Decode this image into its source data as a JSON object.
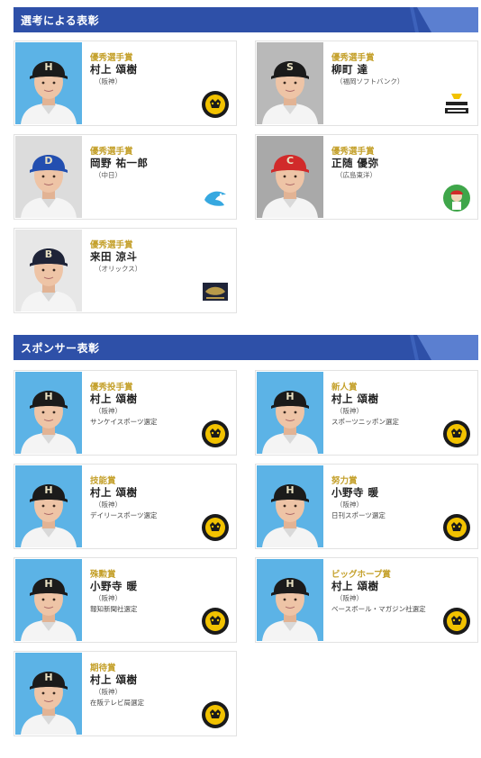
{
  "sections": [
    {
      "title": "選考による表彰",
      "cards": [
        {
          "award": "優秀選手賞",
          "name": "村上 頌樹",
          "team": "（阪神）",
          "sponsor": "",
          "photo_bg": "#5cb3e6",
          "cap": "#1b1b1b",
          "cap_mark": "H",
          "logo": "tigers-logo"
        },
        {
          "award": "優秀選手賞",
          "name": "柳町 達",
          "team": "（福岡ソフトバンク）",
          "sponsor": "",
          "photo_bg": "#b9b9b9",
          "cap": "#1b1b1b",
          "cap_mark": "S",
          "logo": "hawks-logo"
        },
        {
          "award": "優秀選手賞",
          "name": "岡野 祐一郎",
          "team": "（中日）",
          "sponsor": "",
          "photo_bg": "#dcdcdc",
          "cap": "#234fb0",
          "cap_mark": "D",
          "logo": "dragons-logo"
        },
        {
          "award": "優秀選手賞",
          "name": "正随 優弥",
          "team": "（広島東洋）",
          "sponsor": "",
          "photo_bg": "#a9a9a9",
          "cap": "#d12a2a",
          "cap_mark": "C",
          "logo": "carp-logo"
        },
        {
          "award": "優秀選手賞",
          "name": "来田 涼斗",
          "team": "（オリックス）",
          "sponsor": "",
          "photo_bg": "#e7e7e7",
          "cap": "#1f2438",
          "cap_mark": "B",
          "logo": "buffaloes-logo"
        }
      ]
    },
    {
      "title": "スポンサー表彰",
      "cards": [
        {
          "award": "優秀投手賞",
          "name": "村上 頌樹",
          "team": "（阪神）",
          "sponsor": "サンケイスポーツ選定",
          "photo_bg": "#5cb3e6",
          "cap": "#1b1b1b",
          "cap_mark": "H",
          "logo": "tigers-logo"
        },
        {
          "award": "新人賞",
          "name": "村上 頌樹",
          "team": "（阪神）",
          "sponsor": "スポーツニッポン選定",
          "photo_bg": "#5cb3e6",
          "cap": "#1b1b1b",
          "cap_mark": "H",
          "logo": "tigers-logo"
        },
        {
          "award": "技能賞",
          "name": "村上 頌樹",
          "team": "（阪神）",
          "sponsor": "デイリースポーツ選定",
          "photo_bg": "#5cb3e6",
          "cap": "#1b1b1b",
          "cap_mark": "H",
          "logo": "tigers-logo"
        },
        {
          "award": "努力賞",
          "name": "小野寺 暖",
          "team": "（阪神）",
          "sponsor": "日刊スポーツ選定",
          "photo_bg": "#5cb3e6",
          "cap": "#1b1b1b",
          "cap_mark": "H",
          "logo": "tigers-logo"
        },
        {
          "award": "殊勲賞",
          "name": "小野寺 暖",
          "team": "（阪神）",
          "sponsor": "報知新聞社選定",
          "photo_bg": "#5cb3e6",
          "cap": "#1b1b1b",
          "cap_mark": "H",
          "logo": "tigers-logo"
        },
        {
          "award": "ビッグホープ賞",
          "name": "村上 頌樹",
          "team": "（阪神）",
          "sponsor": "ベースボール・マガジン社選定",
          "photo_bg": "#5cb3e6",
          "cap": "#1b1b1b",
          "cap_mark": "H",
          "logo": "tigers-logo"
        },
        {
          "award": "期待賞",
          "name": "村上 頌樹",
          "team": "（阪神）",
          "sponsor": "在阪テレビ局選定",
          "photo_bg": "#5cb3e6",
          "cap": "#1b1b1b",
          "cap_mark": "H",
          "logo": "tigers-logo"
        }
      ]
    }
  ]
}
